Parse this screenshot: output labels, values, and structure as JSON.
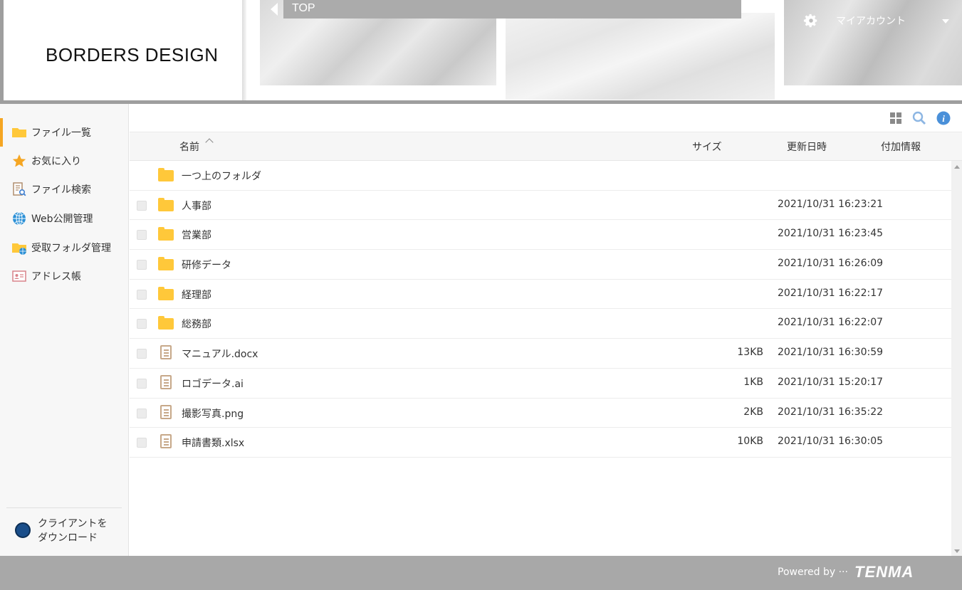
{
  "header": {
    "logo": "BORDERS DESIGN",
    "breadcrumb_top": "TOP",
    "account_label": "マイアカウント"
  },
  "sidebar": {
    "items": [
      {
        "label": "ファイル一覧",
        "icon": "folder-icon",
        "active": true
      },
      {
        "label": "お気に入り",
        "icon": "star-icon"
      },
      {
        "label": "ファイル検索",
        "icon": "file-search-icon"
      },
      {
        "label": "Web公開管理",
        "icon": "globe-icon"
      },
      {
        "label": "受取フォルダ管理",
        "icon": "receive-folder-icon"
      },
      {
        "label": "アドレス帳",
        "icon": "address-book-icon"
      }
    ],
    "download_label_line1": "クライアントを",
    "download_label_line2": "ダウンロード"
  },
  "columns": {
    "name": "名前",
    "size": "サイズ",
    "updated": "更新日時",
    "extra": "付加情報"
  },
  "rows": [
    {
      "type": "folder",
      "name": "一つ上のフォルダ",
      "size": "",
      "date": "",
      "checkbox": false
    },
    {
      "type": "folder",
      "name": "人事部",
      "size": "",
      "date": "2021/10/31 16:23:21",
      "checkbox": true
    },
    {
      "type": "folder",
      "name": "営業部",
      "size": "",
      "date": "2021/10/31 16:23:45",
      "checkbox": true
    },
    {
      "type": "folder",
      "name": "研修データ",
      "size": "",
      "date": "2021/10/31 16:26:09",
      "checkbox": true
    },
    {
      "type": "folder",
      "name": "経理部",
      "size": "",
      "date": "2021/10/31 16:22:17",
      "checkbox": true
    },
    {
      "type": "folder",
      "name": "総務部",
      "size": "",
      "date": "2021/10/31 16:22:07",
      "checkbox": true
    },
    {
      "type": "file",
      "name": "マニュアル.docx",
      "size": "13KB",
      "date": "2021/10/31 16:30:59",
      "checkbox": true
    },
    {
      "type": "file",
      "name": "ロゴデータ.ai",
      "size": "1KB",
      "date": "2021/10/31 15:20:17",
      "checkbox": true
    },
    {
      "type": "file",
      "name": "撮影写真.png",
      "size": "2KB",
      "date": "2021/10/31 16:35:22",
      "checkbox": true
    },
    {
      "type": "file",
      "name": "申請書類.xlsx",
      "size": "10KB",
      "date": "2021/10/31 16:30:05",
      "checkbox": true
    }
  ],
  "footer": {
    "powered": "Powered by ···",
    "brand": "TENMA"
  },
  "colors": {
    "accent": "#f5a623",
    "folder": "#ffc83a",
    "header_gray": "#9e9e9e",
    "footer_gray": "#a8a8a8",
    "info_blue": "#4a90d9"
  }
}
